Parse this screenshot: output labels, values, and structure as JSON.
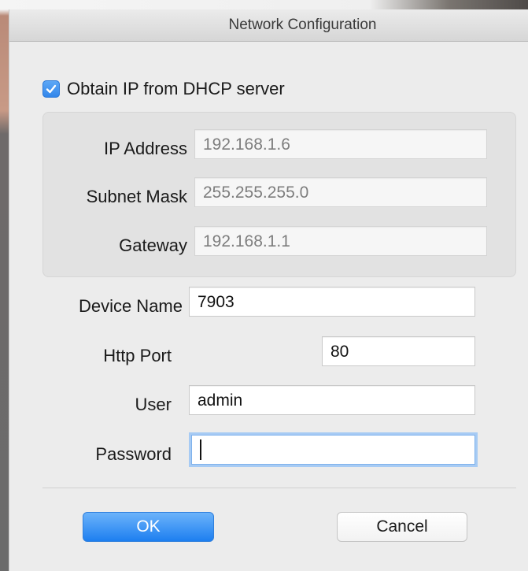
{
  "window": {
    "title": "Network Configuration"
  },
  "dhcp": {
    "label": "Obtain IP from DHCP server",
    "checked": true
  },
  "ip_settings": {
    "ip_address": {
      "label": "IP Address",
      "value": "192.168.1.6"
    },
    "subnet_mask": {
      "label": "Subnet Mask",
      "value": "255.255.255.0"
    },
    "gateway": {
      "label": "Gateway",
      "value": "192.168.1.1"
    }
  },
  "device": {
    "device_name": {
      "label": "Device Name",
      "value": "7903"
    },
    "http_port": {
      "label": "Http Port",
      "value": "80"
    },
    "user": {
      "label": "User",
      "value": "admin"
    },
    "password": {
      "label": "Password",
      "value": ""
    }
  },
  "buttons": {
    "ok": "OK",
    "cancel": "Cancel"
  },
  "colors": {
    "accent": "#2f84ea",
    "focus_ring": "#a7cbf4"
  },
  "icons": {
    "checkbox": "checkmark-icon"
  }
}
